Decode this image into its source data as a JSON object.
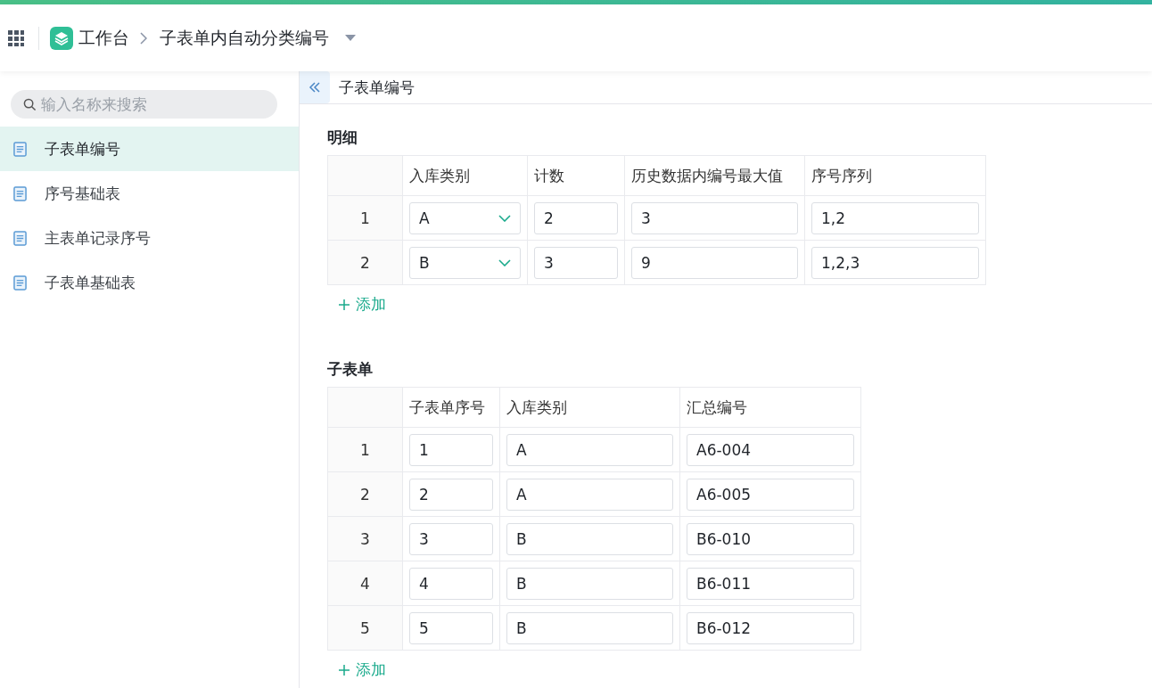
{
  "header": {
    "app_name": "工作台",
    "page_title": "子表单内自动分类编号"
  },
  "sidebar": {
    "search": {
      "placeholder": "输入名称来搜索"
    },
    "items": [
      {
        "label": "子表单编号",
        "selected": true
      },
      {
        "label": "序号基础表",
        "selected": false
      },
      {
        "label": "主表单记录序号",
        "selected": false
      },
      {
        "label": "子表单基础表",
        "selected": false
      }
    ]
  },
  "tab_title": "子表单编号",
  "sections": [
    {
      "title": "明细",
      "columns": [
        {
          "label": "入库类别",
          "kind": "select"
        },
        {
          "label": "计数",
          "kind": "input"
        },
        {
          "label": "历史数据内编号最大值",
          "kind": "input"
        },
        {
          "label": "序号序列",
          "kind": "input"
        }
      ],
      "rows": [
        {
          "index": "1",
          "cells": [
            "A",
            "2",
            "3",
            "1,2"
          ]
        },
        {
          "index": "2",
          "cells": [
            "B",
            "3",
            "9",
            "1,2,3"
          ]
        }
      ],
      "add_label": "添加"
    },
    {
      "title": "子表单",
      "columns": [
        {
          "label": "子表单序号",
          "kind": "input"
        },
        {
          "label": "入库类别",
          "kind": "input"
        },
        {
          "label": "汇总编号",
          "kind": "input"
        }
      ],
      "rows": [
        {
          "index": "1",
          "cells": [
            "1",
            "A",
            "A6-004"
          ]
        },
        {
          "index": "2",
          "cells": [
            "2",
            "A",
            "A6-005"
          ]
        },
        {
          "index": "3",
          "cells": [
            "3",
            "B",
            "B6-010"
          ]
        },
        {
          "index": "4",
          "cells": [
            "4",
            "B",
            "B6-011"
          ]
        },
        {
          "index": "5",
          "cells": [
            "5",
            "B",
            "B6-012"
          ]
        }
      ],
      "add_label": "添加"
    }
  ]
}
